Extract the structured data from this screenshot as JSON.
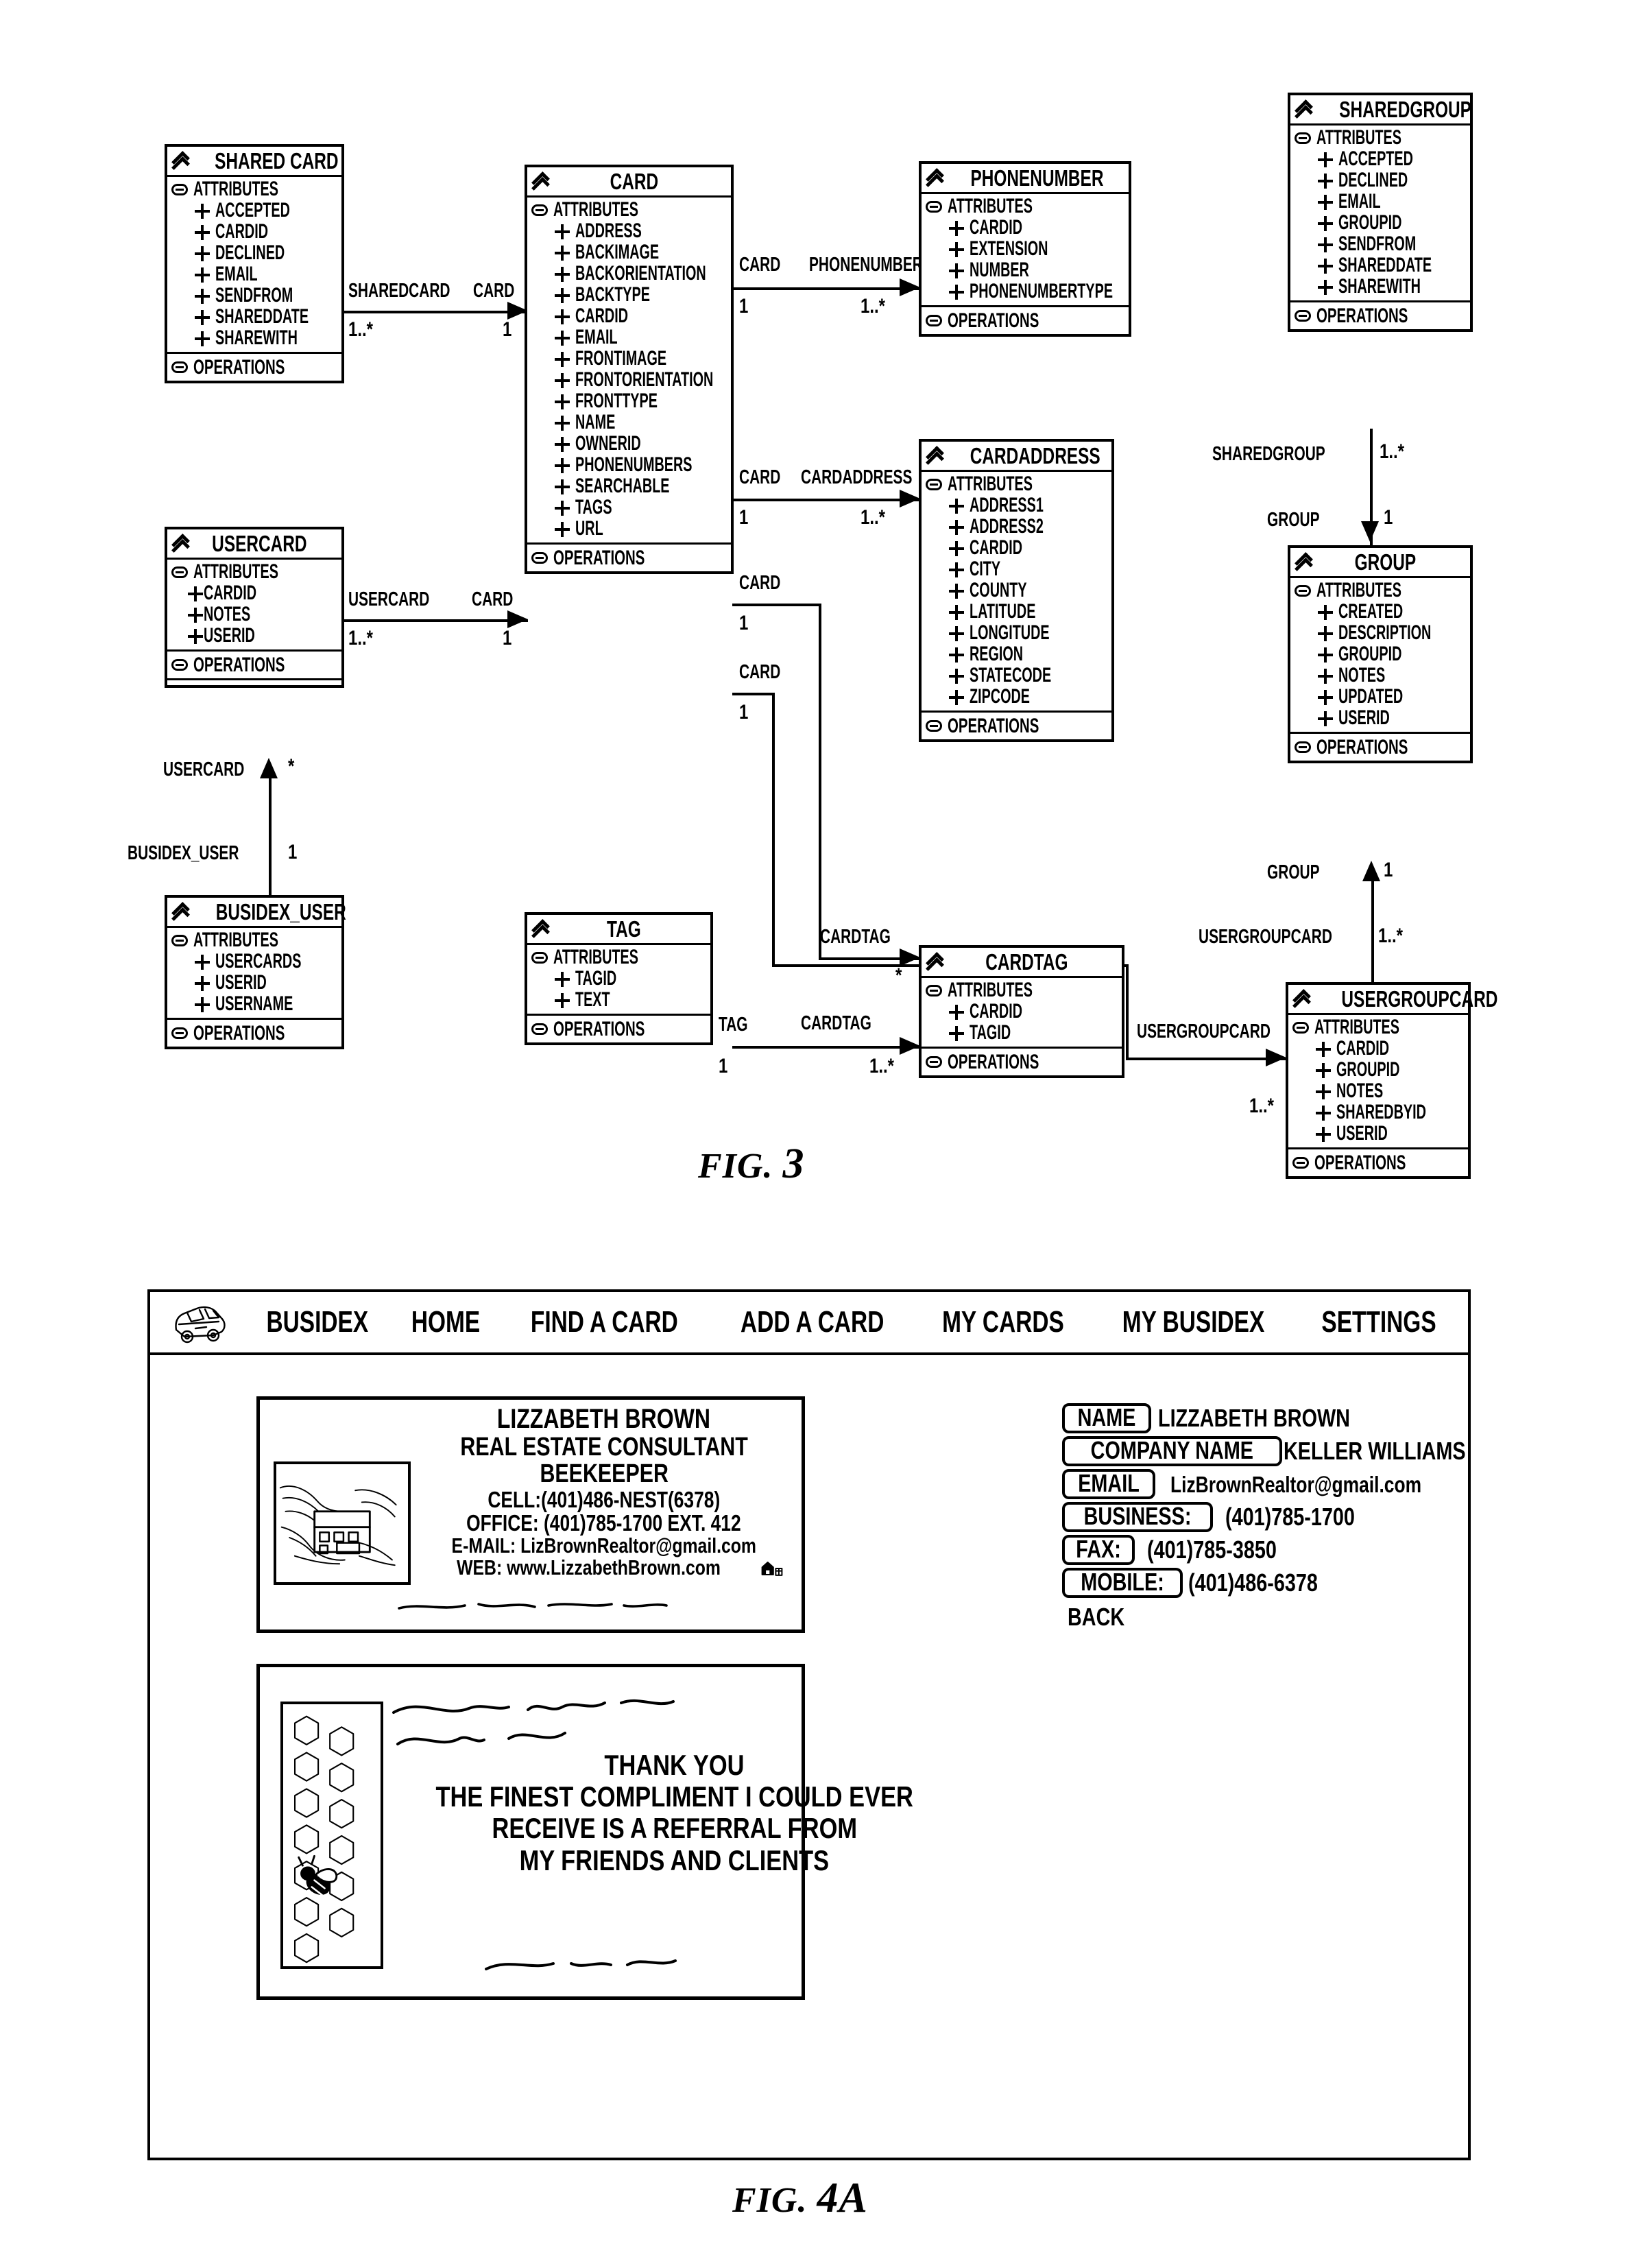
{
  "figures": {
    "fig3": {
      "caption_prefix": "FIG.",
      "caption_number": "3"
    },
    "fig4a": {
      "caption_prefix": "FIG.",
      "caption_number": "4A"
    }
  },
  "uml": {
    "section_keywords": {
      "attributes": "ATTRIBUTES",
      "operations": "OPERATIONS"
    },
    "classes": [
      {
        "id": "sharedcard",
        "name": "SHARED CARD",
        "attributes": [
          "ACCEPTED",
          "CARDID",
          "DECLINED",
          "EMAIL",
          "SENDFROM",
          "SHAREDDATE",
          "SHAREWITH"
        ]
      },
      {
        "id": "usercard",
        "name": "USERCARD",
        "attributes": [
          "CARDID",
          "NOTES",
          "USERID"
        ]
      },
      {
        "id": "busidexuser",
        "name": "BUSIDEX_USER",
        "attributes": [
          "USERCARDS",
          "USERID",
          "USERNAME"
        ]
      },
      {
        "id": "card",
        "name": "CARD",
        "attributes": [
          "ADDRESS",
          "BACKIMAGE",
          "BACKORIENTATION",
          "BACKTYPE",
          "CARDID",
          "EMAIL",
          "FRONTIMAGE",
          "FRONTORIENTATION",
          "FRONTTYPE",
          "NAME",
          "OWNERID",
          "PHONENUMBERS",
          "SEARCHABLE",
          "TAGS",
          "URL"
        ]
      },
      {
        "id": "tag",
        "name": "TAG",
        "attributes": [
          "TAGID",
          "TEXT"
        ]
      },
      {
        "id": "phonenumber",
        "name": "PHONENUMBER",
        "attributes": [
          "CARDID",
          "EXTENSION",
          "NUMBER",
          "PHONENUMBERTYPE"
        ]
      },
      {
        "id": "cardaddress",
        "name": "CARDADDRESS",
        "attributes": [
          "ADDRESS1",
          "ADDRESS2",
          "CARDID",
          "CITY",
          "COUNTY",
          "LATITUDE",
          "LONGITUDE",
          "REGION",
          "STATECODE",
          "ZIPCODE"
        ]
      },
      {
        "id": "cardtag",
        "name": "CARDTAG",
        "attributes": [
          "CARDID",
          "TAGID"
        ]
      },
      {
        "id": "sharedgroup",
        "name": "SHAREDGROUP",
        "attributes": [
          "ACCEPTED",
          "DECLINED",
          "EMAIL",
          "GROUPID",
          "SENDFROM",
          "SHAREDDATE",
          "SHAREWITH"
        ]
      },
      {
        "id": "group",
        "name": "GROUP",
        "attributes": [
          "CREATED",
          "DESCRIPTION",
          "GROUPID",
          "NOTES",
          "UPDATED",
          "USERID"
        ]
      },
      {
        "id": "usergroupcard",
        "name": "USERGROUPCARD",
        "attributes": [
          "CARDID",
          "GROUPID",
          "NOTES",
          "SHAREDBYID",
          "USERID"
        ]
      }
    ],
    "relations": [
      {
        "id": "sharedcard-card",
        "source_role": "SHAREDCARD",
        "target_role": "CARD",
        "source_mult": "1..*",
        "target_mult": "1"
      },
      {
        "id": "usercard-card",
        "source_role": "USERCARD",
        "target_role": "CARD",
        "source_mult": "1..*",
        "target_mult": "1"
      },
      {
        "id": "busidexuser-usercard",
        "source_role": "BUSIDEX_USER",
        "target_role": "USERCARD",
        "source_mult": "1",
        "target_mult": "*"
      },
      {
        "id": "card-phonenumber",
        "source_role": "CARD",
        "target_role": "PHONENUMBER",
        "source_mult": "1",
        "target_mult": "1..*"
      },
      {
        "id": "card-cardaddress",
        "source_role": "CARD",
        "target_role": "CARDADDRESS",
        "source_mult": "1",
        "target_mult": "1..*"
      },
      {
        "id": "card-cardtag-top",
        "source_role": "CARD",
        "target_role": "CARDTAG",
        "source_mult": "1",
        "target_mult": "*"
      },
      {
        "id": "card-usergroupcard",
        "source_role": "CARD",
        "target_role": "USERGROUPCARD",
        "source_mult": "1",
        "target_mult": "1..*"
      },
      {
        "id": "tag-cardtag",
        "source_role": "TAG",
        "target_role": "CARDTAG",
        "source_mult": "1",
        "target_mult": "1..*"
      },
      {
        "id": "sharedgroup-group",
        "source_role": "SHAREDGROUP",
        "target_role": "GROUP",
        "source_mult": "1..*",
        "target_mult": "1"
      },
      {
        "id": "group-usergroupcard",
        "source_role": "GROUP",
        "target_role": "USERGROUPCARD",
        "source_mult": "1",
        "target_mult": "1..*"
      }
    ],
    "edge_labels": {
      "sharedcard_left": "SHAREDCARD",
      "sharedcard_right": "CARD",
      "sharedcard_mult_left": "1..*",
      "sharedcard_mult_right": "1",
      "usercard_left": "USERCARD",
      "usercard_right": "CARD",
      "usercard_mult_left": "1..*",
      "usercard_mult_right": "1",
      "usercard_up": "USERCARD",
      "usercard_up_mult": "*",
      "busidexuser_up": "BUSIDEX_USER",
      "busidexuser_up_mult": "1",
      "card_pn_left": "CARD",
      "card_pn_right": "PHONENUMBER",
      "card_pn_mult_left": "1",
      "card_pn_mult_right": "1..*",
      "card_ca_left": "CARD",
      "card_ca_right": "CARDADDRESS",
      "card_ca_mult_left": "1",
      "card_ca_mult_right": "1..*",
      "card_ct_left": "CARD",
      "card_ct_mult_left": "1",
      "card_ct_right": "CARDTAG",
      "card_ct_mult_right": "*",
      "card_ugc_left": "CARD",
      "card_ugc_mult_left": "1",
      "tag_left": "TAG",
      "tag_mult_left": "1",
      "tag_right": "CARDTAG",
      "tag_mult_right": "1..*",
      "sharedgroup_label": "SHAREDGROUP",
      "sharedgroup_mult": "1..*",
      "group_down_label": "GROUP",
      "group_down_mult": "1",
      "group_up_label": "GROUP",
      "group_up_mult": "1",
      "usergroupcard_label": "USERGROUPCARD",
      "usergroupcard_mult": "1..*",
      "usergroupcard_left_label": "USERGROUPCARD",
      "usergroupcard_left_mult": "1..*"
    }
  },
  "app": {
    "nav": {
      "logo_icon": "car-icon",
      "items": [
        {
          "id": "busidex",
          "label": "BUSIDEX"
        },
        {
          "id": "home",
          "label": "HOME"
        },
        {
          "id": "find-a-card",
          "label": "FIND A CARD"
        },
        {
          "id": "add-a-card",
          "label": "ADD A CARD"
        },
        {
          "id": "my-cards",
          "label": "MY CARDS"
        },
        {
          "id": "my-busidex",
          "label": "MY BUSIDEX"
        },
        {
          "id": "settings",
          "label": "SETTINGS"
        }
      ]
    },
    "card_front": {
      "logo_icon": "house-in-hands-icon",
      "name": "LIZZABETH BROWN",
      "role": "REAL ESTATE CONSULTANT",
      "role2": "BEEKEEPER",
      "cell": "CELL:(401)486-NEST(6378)",
      "office": "OFFICE: (401)785-1700 EXT. 412",
      "email": "E-MAIL: LizBrownRealtor@gmail.com",
      "web": "WEB: www.LizzabethBrown.com",
      "web_icon": "house-icon"
    },
    "card_back": {
      "hive_icon": "honeycomb-bee-icon",
      "line1": "THANK YOU",
      "line2": "THE FINEST COMPLIMENT I COULD EVER",
      "line3": "RECEIVE IS A REFERRAL FROM",
      "line4": "MY FRIENDS AND CLIENTS"
    },
    "detail": {
      "rows": [
        {
          "id": "name",
          "tag": "NAME",
          "value": "LIZZABETH BROWN"
        },
        {
          "id": "company-name",
          "tag": "COMPANY NAME",
          "value": "KELLER WILLIAMS"
        },
        {
          "id": "email",
          "tag": "EMAIL",
          "value": "LizBrownRealtor@gmail.com"
        },
        {
          "id": "business",
          "tag": "BUSINESS:",
          "value": "(401)785-1700"
        },
        {
          "id": "fax",
          "tag": "FAX:",
          "value": "(401)785-3850"
        },
        {
          "id": "mobile",
          "tag": "MOBILE:",
          "value": "(401)486-6378"
        }
      ],
      "back_label": "BACK"
    }
  },
  "colors": {
    "ink": "#000000",
    "paper": "#ffffff"
  }
}
